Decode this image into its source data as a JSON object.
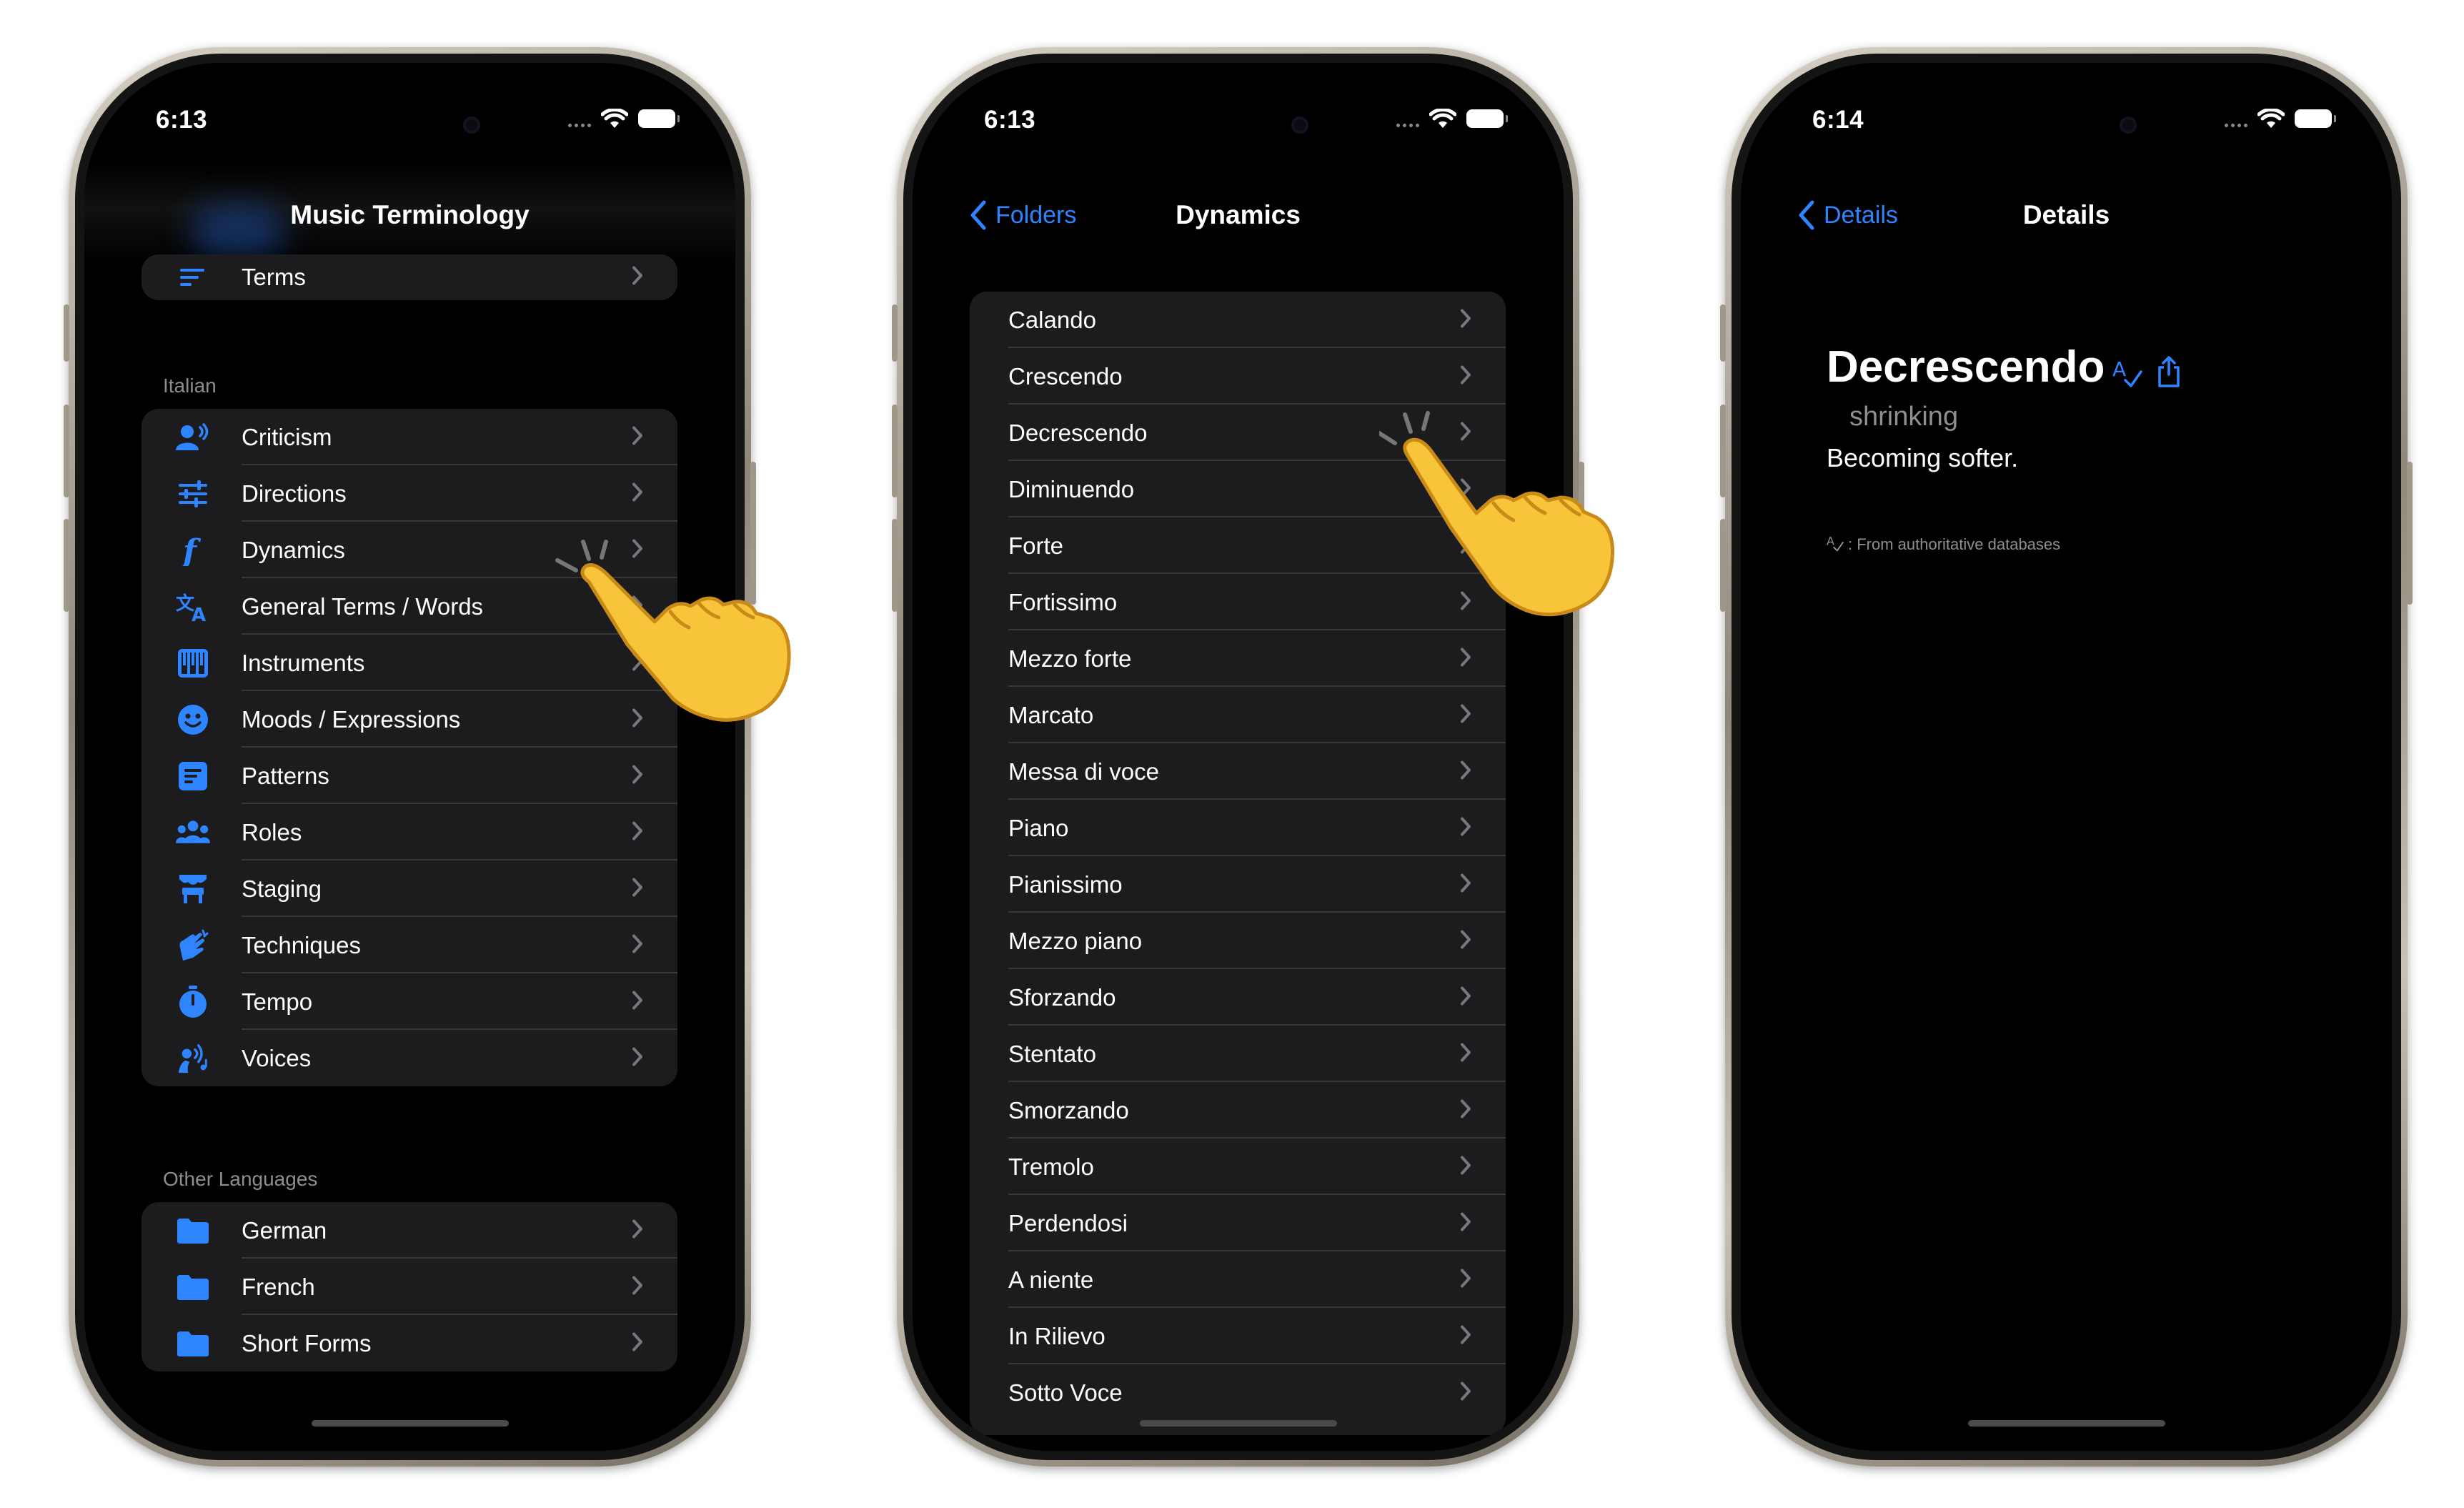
{
  "colors": {
    "accent": "#2e85ff",
    "row_bg": "#1c1c1e",
    "separator": "#38383a",
    "secondary_text": "#8d8d93"
  },
  "phones": [
    {
      "status": {
        "time": "6:13"
      },
      "title": "Music Terminology",
      "top_item": {
        "label": "Terms",
        "icon": "text-align-left-icon"
      },
      "italian": {
        "header": "Italian",
        "items": [
          {
            "label": "Criticism",
            "icon": "person-speaking-icon"
          },
          {
            "label": "Directions",
            "icon": "sliders-icon"
          },
          {
            "label": "Dynamics",
            "icon": "forte-f-icon"
          },
          {
            "label": "General Terms / Words",
            "icon": "translate-icon"
          },
          {
            "label": "Instruments",
            "icon": "piano-keys-icon"
          },
          {
            "label": "Moods / Expressions",
            "icon": "smiley-icon"
          },
          {
            "label": "Patterns",
            "icon": "list-square-icon"
          },
          {
            "label": "Roles",
            "icon": "people-icon"
          },
          {
            "label": "Staging",
            "icon": "theater-stage-icon"
          },
          {
            "label": "Techniques",
            "icon": "hands-clapping-icon"
          },
          {
            "label": "Tempo",
            "icon": "timer-icon"
          },
          {
            "label": "Voices",
            "icon": "singer-icon"
          }
        ]
      },
      "other": {
        "header": "Other Languages",
        "items": [
          {
            "label": "German",
            "icon": "folder-icon"
          },
          {
            "label": "French",
            "icon": "folder-icon"
          },
          {
            "label": "Short Forms",
            "icon": "folder-icon"
          }
        ]
      }
    },
    {
      "status": {
        "time": "6:13"
      },
      "back_label": "Folders",
      "title": "Dynamics",
      "items": [
        "Calando",
        "Crescendo",
        "Decrescendo",
        "Diminuendo",
        "Forte",
        "Fortissimo",
        "Mezzo forte",
        "Marcato",
        "Messa di voce",
        "Piano",
        "Pianissimo",
        "Mezzo piano",
        "Sforzando",
        "Stentato",
        "Smorzando",
        "Tremolo",
        "Perdendosi",
        "A niente",
        "In Rilievo",
        "Sotto Voce"
      ]
    },
    {
      "status": {
        "time": "6:14"
      },
      "back_label": "Details",
      "title": "Details",
      "word": "Decrescendo",
      "translation": "shrinking",
      "definition": "Becoming softer.",
      "source_note": ": From authoritative databases"
    }
  ]
}
